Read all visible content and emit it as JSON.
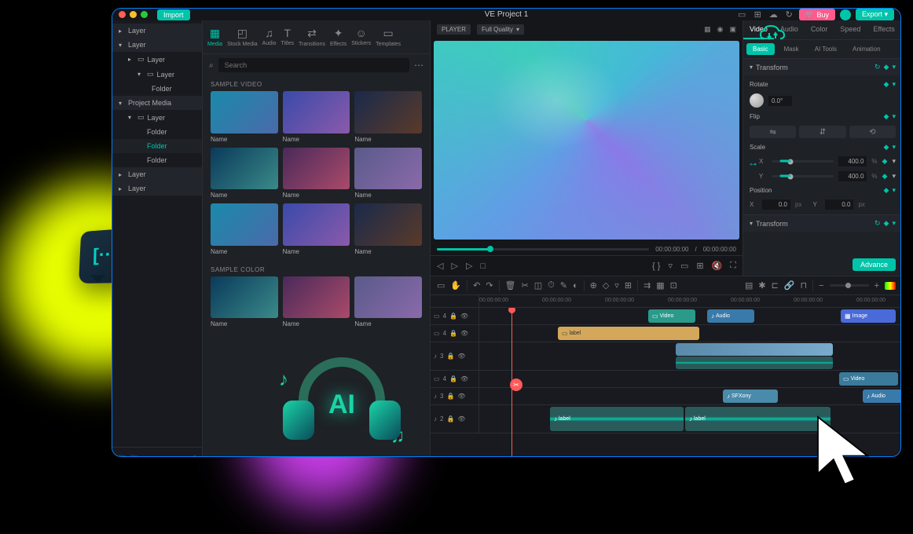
{
  "app": {
    "title": "VE Project 1",
    "import": "Import",
    "buy": "Buy",
    "export": "Export"
  },
  "top_tabs": [
    {
      "label": "Media",
      "icon": "▦"
    },
    {
      "label": "Stock Media",
      "icon": "◰"
    },
    {
      "label": "Audio",
      "icon": "♫"
    },
    {
      "label": "Titles",
      "icon": "T"
    },
    {
      "label": "Transitions",
      "icon": "⇄"
    },
    {
      "label": "Effects",
      "icon": "✦"
    },
    {
      "label": "Stickers",
      "icon": "☺"
    },
    {
      "label": "Templates",
      "icon": "▭"
    }
  ],
  "sidebar": {
    "items": [
      {
        "label": "Layer",
        "type": "header",
        "chev": "▸"
      },
      {
        "label": "Layer",
        "type": "header",
        "chev": "▾"
      },
      {
        "label": "Layer",
        "indent": 1,
        "chev": "▸",
        "icon": "▭"
      },
      {
        "label": "Layer",
        "indent": 2,
        "chev": "▾",
        "icon": "▭"
      },
      {
        "label": "Folder",
        "indent": 3
      },
      {
        "label": "Project Media",
        "type": "header",
        "chev": "▾",
        "active": true
      },
      {
        "label": "Layer",
        "indent": 1,
        "chev": "▾",
        "icon": "▭",
        "active": true
      },
      {
        "label": "Folder",
        "indent": 2
      },
      {
        "label": "Folder",
        "indent": 2,
        "selected": true
      },
      {
        "label": "Folder",
        "indent": 2
      },
      {
        "label": "Layer",
        "type": "header",
        "chev": "▸"
      },
      {
        "label": "Layer",
        "type": "header",
        "chev": "▸"
      }
    ]
  },
  "media": {
    "search_placeholder": "Search",
    "section1": "SAMPLE VIDEO",
    "section2": "SAMPLE COLOR",
    "thumb_label": "Name"
  },
  "preview": {
    "player_label": "PLAYER",
    "quality": "Full Quality",
    "time_current": "00:00:00:00",
    "time_separator": "/",
    "time_total": "00:00:00:00"
  },
  "inspector": {
    "tabs": [
      "Video",
      "Audio",
      "Color",
      "Speed",
      "Effects"
    ],
    "subtabs": [
      "Basic",
      "Mask",
      "AI Tools",
      "Animation"
    ],
    "transform_label": "Transform",
    "rotate_label": "Rotate",
    "rotate_value": "0.0",
    "rotate_unit": "°",
    "flip_label": "Flip",
    "scale_label": "Scale",
    "scale_x": "400.0",
    "scale_y": "400.0",
    "scale_unit": "%",
    "position_label": "Position",
    "pos_x": "0.0",
    "pos_y": "0.0",
    "pos_unit": "px",
    "x_label": "X",
    "y_label": "Y",
    "advance": "Advance"
  },
  "timeline": {
    "ruler": [
      "00:00:00:00",
      "00:00:00:00",
      "00:00:00:00",
      "00:00:00:00",
      "00:00:00:00",
      "00:00:00:00",
      "00:00:00:00"
    ],
    "clips": {
      "video": "Video",
      "audio": "Audio",
      "image": "Image",
      "label": "label",
      "sfxony": "SFXony"
    },
    "track_nums": [
      "4",
      "4",
      "3",
      "4",
      "3",
      "2"
    ]
  }
}
